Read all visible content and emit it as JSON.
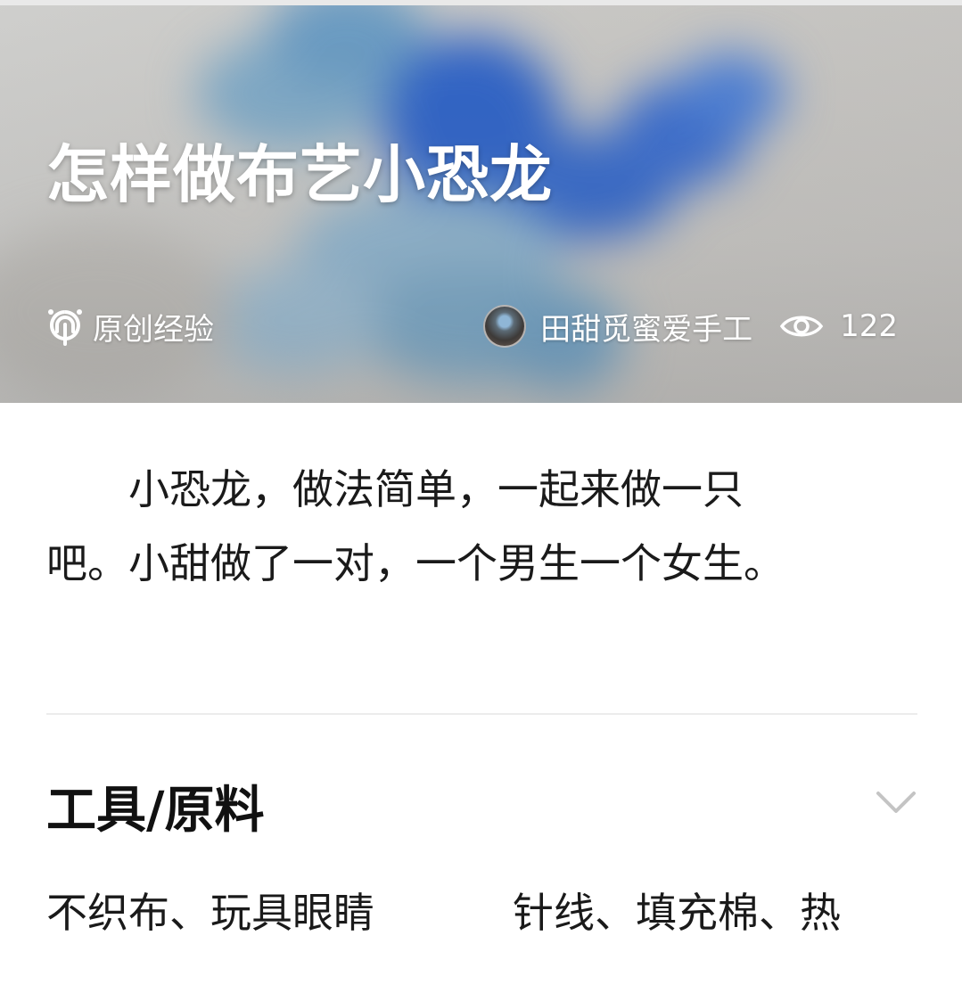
{
  "hero": {
    "title": "怎样做布艺小恐龙",
    "original_label": "原创经验",
    "author": "田甜觅蜜爱手工",
    "views": "122",
    "icons": {
      "original": "original-badge-icon",
      "views": "eye-icon"
    },
    "colors": {
      "dino_blue": "#2d5fbf",
      "dino_light": "#7aa8c8",
      "background": "#c8c7c4"
    }
  },
  "intro": {
    "text": "小恐龙，做法简单，一起来做一只吧。小甜做了一对，一个男生一个女生。"
  },
  "materials": {
    "title": "工具/原料",
    "items": [
      "不织布、玩具眼睛",
      "针线、填充棉、热"
    ],
    "toggle_icon": "chevron-down-icon"
  }
}
